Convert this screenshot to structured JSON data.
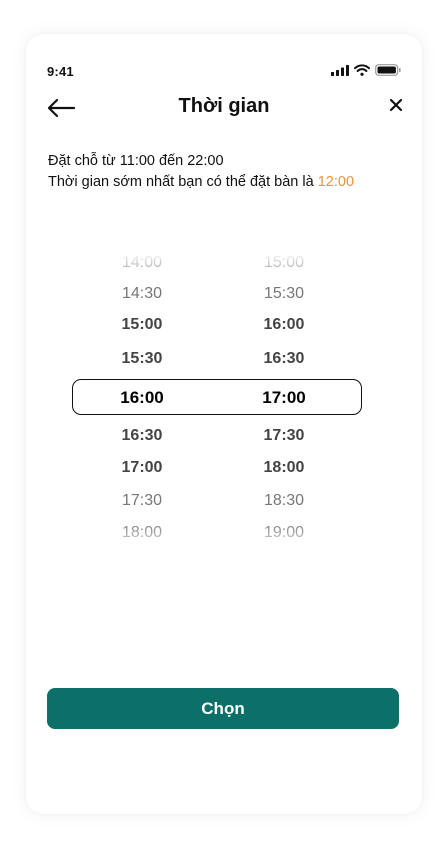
{
  "status_bar": {
    "time": "9:41"
  },
  "header": {
    "title": "Thời gian"
  },
  "info": {
    "line1": "Đặt chỗ từ 11:00 đến 22:00",
    "line2_prefix": "Thời gian sớm nhất bạn có thể đặt bàn là ",
    "earliest_time": "12:00"
  },
  "picker": {
    "start_times": [
      "14:00",
      "14:30",
      "15:00",
      "15:30",
      "16:00",
      "16:30",
      "17:00",
      "17:30",
      "18:00"
    ],
    "end_times": [
      "15:00",
      "15:30",
      "16:00",
      "16:30",
      "17:00",
      "17:30",
      "18:00",
      "18:30",
      "19:00"
    ],
    "selected_start": "16:00",
    "selected_end": "17:00"
  },
  "actions": {
    "choose_label": "Chọn"
  },
  "colors": {
    "accent": "#f0913a",
    "primary": "#0c7068"
  }
}
